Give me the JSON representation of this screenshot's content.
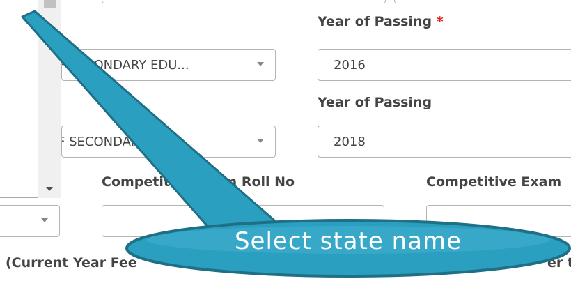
{
  "form": {
    "year_of_passing_label_1": "Year of Passing",
    "required_marker": "*",
    "board_select_1_value": "F SECONDARY EDU...",
    "year_of_passing_value_1": "2016",
    "year_of_passing_label_2": "Year of Passing",
    "board_select_2_value": "F SECONDARY EDU...",
    "year_of_passing_value_2": "2018",
    "competitive_roll_label": "Competitive Exam Roll No",
    "competitive_exam_label": "Competitive Exam",
    "state_select_value": "",
    "competitive_roll_value": "",
    "competitive_exam_value": "",
    "bottom_note": "(Current Year Fee",
    "bottom_note_right": "er th"
  },
  "callout": {
    "text": "Select state name",
    "fill": "#2a9fc0",
    "stroke": "#1f6f86"
  },
  "icons": {
    "dropdown_caret": "caret-down-icon",
    "scroll_down": "scroll-down-arrow-icon"
  }
}
